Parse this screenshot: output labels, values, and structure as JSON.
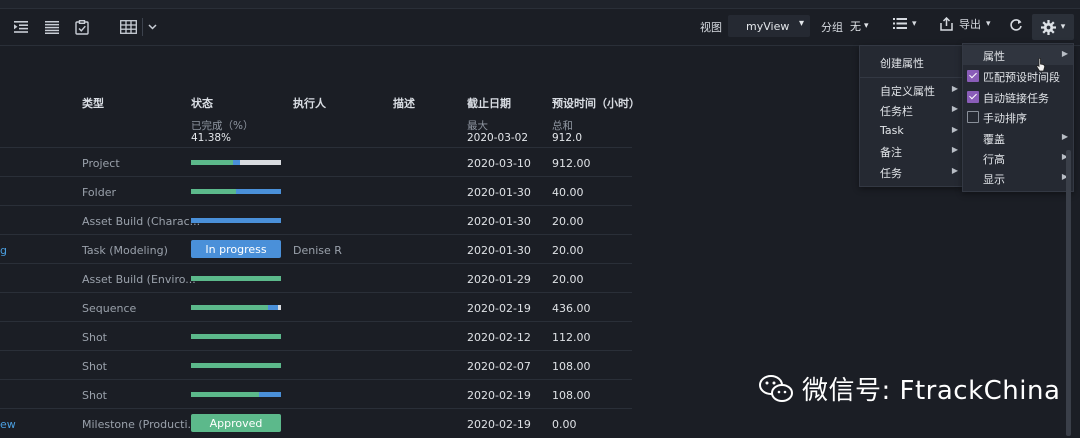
{
  "toolbar": {
    "view_label": "视图",
    "view_value": "myView",
    "group_label": "分组",
    "group_value": "无",
    "export_label": "导出"
  },
  "table": {
    "headers": [
      "类型",
      "状态",
      "执行人",
      "描述",
      "截止日期",
      "预设时间（小时）"
    ],
    "summary": {
      "status_label": "已完成（%）",
      "status_value": "41.38%",
      "date_label": "最大",
      "date_value": "2020-03-02",
      "time_label": "总和",
      "time_value": "912.0"
    },
    "rows": [
      {
        "name": "",
        "type": "Project",
        "status": {
          "kind": "bar",
          "segments": [
            {
              "color": "#5cb98b",
              "frac": 0.47
            },
            {
              "color": "#4a90d9",
              "frac": 0.08
            },
            {
              "color": "#d9dce0",
              "frac": 0.45
            }
          ]
        },
        "assignee": "",
        "date": "2020-03-10",
        "time": "912.00"
      },
      {
        "name": "",
        "type": "Folder",
        "status": {
          "kind": "bar",
          "segments": [
            {
              "color": "#5cb98b",
              "frac": 0.5
            },
            {
              "color": "#4a90d9",
              "frac": 0.5
            }
          ]
        },
        "assignee": "",
        "date": "2020-01-30",
        "time": "40.00"
      },
      {
        "name": "",
        "type": "Asset Build (Charac...",
        "status": {
          "kind": "bar",
          "segments": [
            {
              "color": "#4a90d9",
              "frac": 1.0
            }
          ]
        },
        "assignee": "",
        "date": "2020-01-30",
        "time": "20.00"
      },
      {
        "name": "g",
        "type": "Task (Modeling)",
        "status": {
          "kind": "badge",
          "label": "In progress",
          "color": "#4a90d9"
        },
        "assignee": "Denise R",
        "date": "2020-01-30",
        "time": "20.00"
      },
      {
        "name": "",
        "type": "Asset Build (Enviro...",
        "status": {
          "kind": "bar",
          "segments": [
            {
              "color": "#5cb98b",
              "frac": 1.0
            }
          ]
        },
        "assignee": "",
        "date": "2020-01-29",
        "time": "20.00"
      },
      {
        "name": "",
        "type": "Sequence",
        "status": {
          "kind": "bar",
          "segments": [
            {
              "color": "#5cb98b",
              "frac": 0.85
            },
            {
              "color": "#4a90d9",
              "frac": 0.12
            },
            {
              "color": "#d9dce0",
              "frac": 0.03
            }
          ]
        },
        "assignee": "",
        "date": "2020-02-19",
        "time": "436.00"
      },
      {
        "name": "",
        "type": "Shot",
        "status": {
          "kind": "bar",
          "segments": [
            {
              "color": "#5cb98b",
              "frac": 1.0
            }
          ]
        },
        "assignee": "",
        "date": "2020-02-12",
        "time": "112.00"
      },
      {
        "name": "",
        "type": "Shot",
        "status": {
          "kind": "bar",
          "segments": [
            {
              "color": "#5cb98b",
              "frac": 1.0
            }
          ]
        },
        "assignee": "",
        "date": "2020-02-07",
        "time": "108.00"
      },
      {
        "name": "",
        "type": "Shot",
        "status": {
          "kind": "bar",
          "segments": [
            {
              "color": "#5cb98b",
              "frac": 0.75
            },
            {
              "color": "#4a90d9",
              "frac": 0.25
            }
          ]
        },
        "assignee": "",
        "date": "2020-02-19",
        "time": "108.00"
      },
      {
        "name": "ew",
        "type": "Milestone (Producti...",
        "status": {
          "kind": "badge",
          "label": "Approved",
          "color": "#5cb98b"
        },
        "assignee": "",
        "date": "2020-02-19",
        "time": "0.00"
      }
    ]
  },
  "menu_main": {
    "items": [
      {
        "label": "创建属性",
        "submenu": false
      },
      {
        "label": "自定义属性",
        "submenu": true
      },
      {
        "label": "任务栏",
        "submenu": true
      },
      {
        "label": "Task",
        "submenu": true
      },
      {
        "label": "备注",
        "submenu": true
      },
      {
        "label": "任务",
        "submenu": true
      }
    ]
  },
  "menu_settings": {
    "items": [
      {
        "label": "属性",
        "submenu": true,
        "checkbox": null
      },
      {
        "label": "匹配预设时间段",
        "submenu": false,
        "checkbox": true
      },
      {
        "label": "自动链接任务",
        "submenu": false,
        "checkbox": true
      },
      {
        "label": "手动排序",
        "submenu": false,
        "checkbox": false
      },
      {
        "label": "覆盖",
        "submenu": true,
        "checkbox": null
      },
      {
        "label": "行高",
        "submenu": true,
        "checkbox": null
      },
      {
        "label": "显示",
        "submenu": true,
        "checkbox": null
      }
    ]
  },
  "watermark": {
    "text": "微信号: FtrackChina"
  },
  "colors": {
    "background": "#1b1e25",
    "done": "#5cb98b",
    "in_progress": "#4a90d9",
    "not_started": "#d9dce0",
    "check_accent": "#8a5db8"
  }
}
